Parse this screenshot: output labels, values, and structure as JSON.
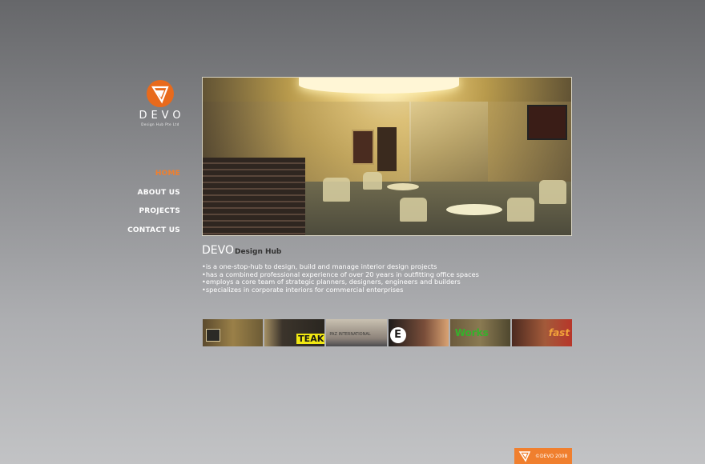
{
  "logo": {
    "icon": "devo-logo-icon",
    "name": "DEVO",
    "tagline": "Design Hub Pte Ltd"
  },
  "nav": {
    "items": [
      {
        "label": "HOME",
        "active": true
      },
      {
        "label": "ABOUT US",
        "active": false
      },
      {
        "label": "PROJECTS",
        "active": false
      },
      {
        "label": "CONTACT US",
        "active": false
      }
    ]
  },
  "content": {
    "brand": "DEVO",
    "subtitle": "Design Hub",
    "bullets": [
      "is a one-stop-hub to design, build and manage interior design projects",
      "has a combined professional experience of over 20 years in outfitting office spaces",
      "employs a core team of strategic planners, designers, engineers and builders",
      "specializes in corporate interiors for commercial enterprises"
    ]
  },
  "thumbnails": {
    "signs": [
      "",
      "TEAK",
      "PAZ INTERNATIONAL",
      "E",
      "Works",
      "fast"
    ]
  },
  "footer": {
    "copyright": "©DEVO 2008"
  },
  "colors": {
    "accent": "#f07f2e",
    "text": "#ffffff"
  }
}
